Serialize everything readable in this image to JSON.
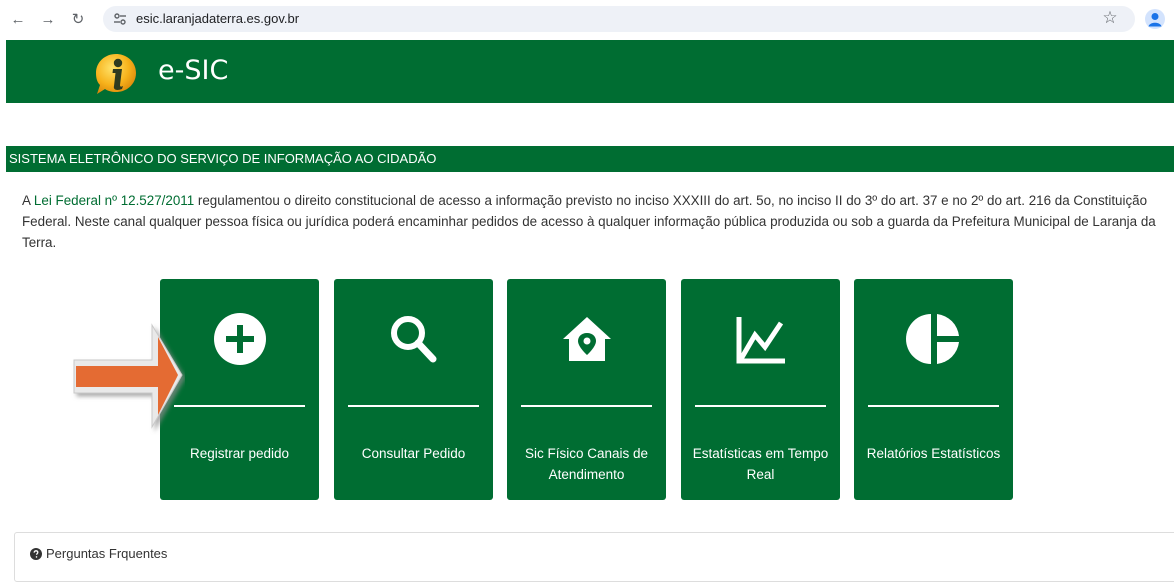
{
  "browser": {
    "url": "esic.laranjadaterra.es.gov.br",
    "back_icon": "←",
    "forward_icon": "→",
    "reload_icon": "↻",
    "star_icon": "☆"
  },
  "header": {
    "brand": "e-SIC"
  },
  "section": {
    "title": "SISTEMA ELETRÔNICO DO SERVIÇO DE INFORMAÇÃO AO CIDADÃO"
  },
  "intro": {
    "prefix": "A ",
    "link": "Lei Federal nº 12.527/2011",
    "text": " regulamentou o direito constitucional de acesso a informação previsto no inciso XXXIII do art. 5o, no inciso II do 3º do art. 37 e no 2º do art. 216 da Constituição Federal. Neste canal qualquer pessoa física ou jurídica poderá encaminhar pedidos de acesso à qualquer informação pública produzida ou sob a guarda da Prefeitura Municipal de Laranja da Terra."
  },
  "cards": [
    {
      "label": "Registrar pedido"
    },
    {
      "label": "Consultar Pedido"
    },
    {
      "label": "Sic Físico Canais de Atendimento"
    },
    {
      "label": "Estatísticas em Tempo Real"
    },
    {
      "label": "Relatórios Estatísticos"
    }
  ],
  "faq": {
    "label": "Perguntas Frquentes"
  },
  "colors": {
    "brand_green": "#006d32",
    "arrow_orange": "#e46b33",
    "link_green": "#006d32"
  }
}
